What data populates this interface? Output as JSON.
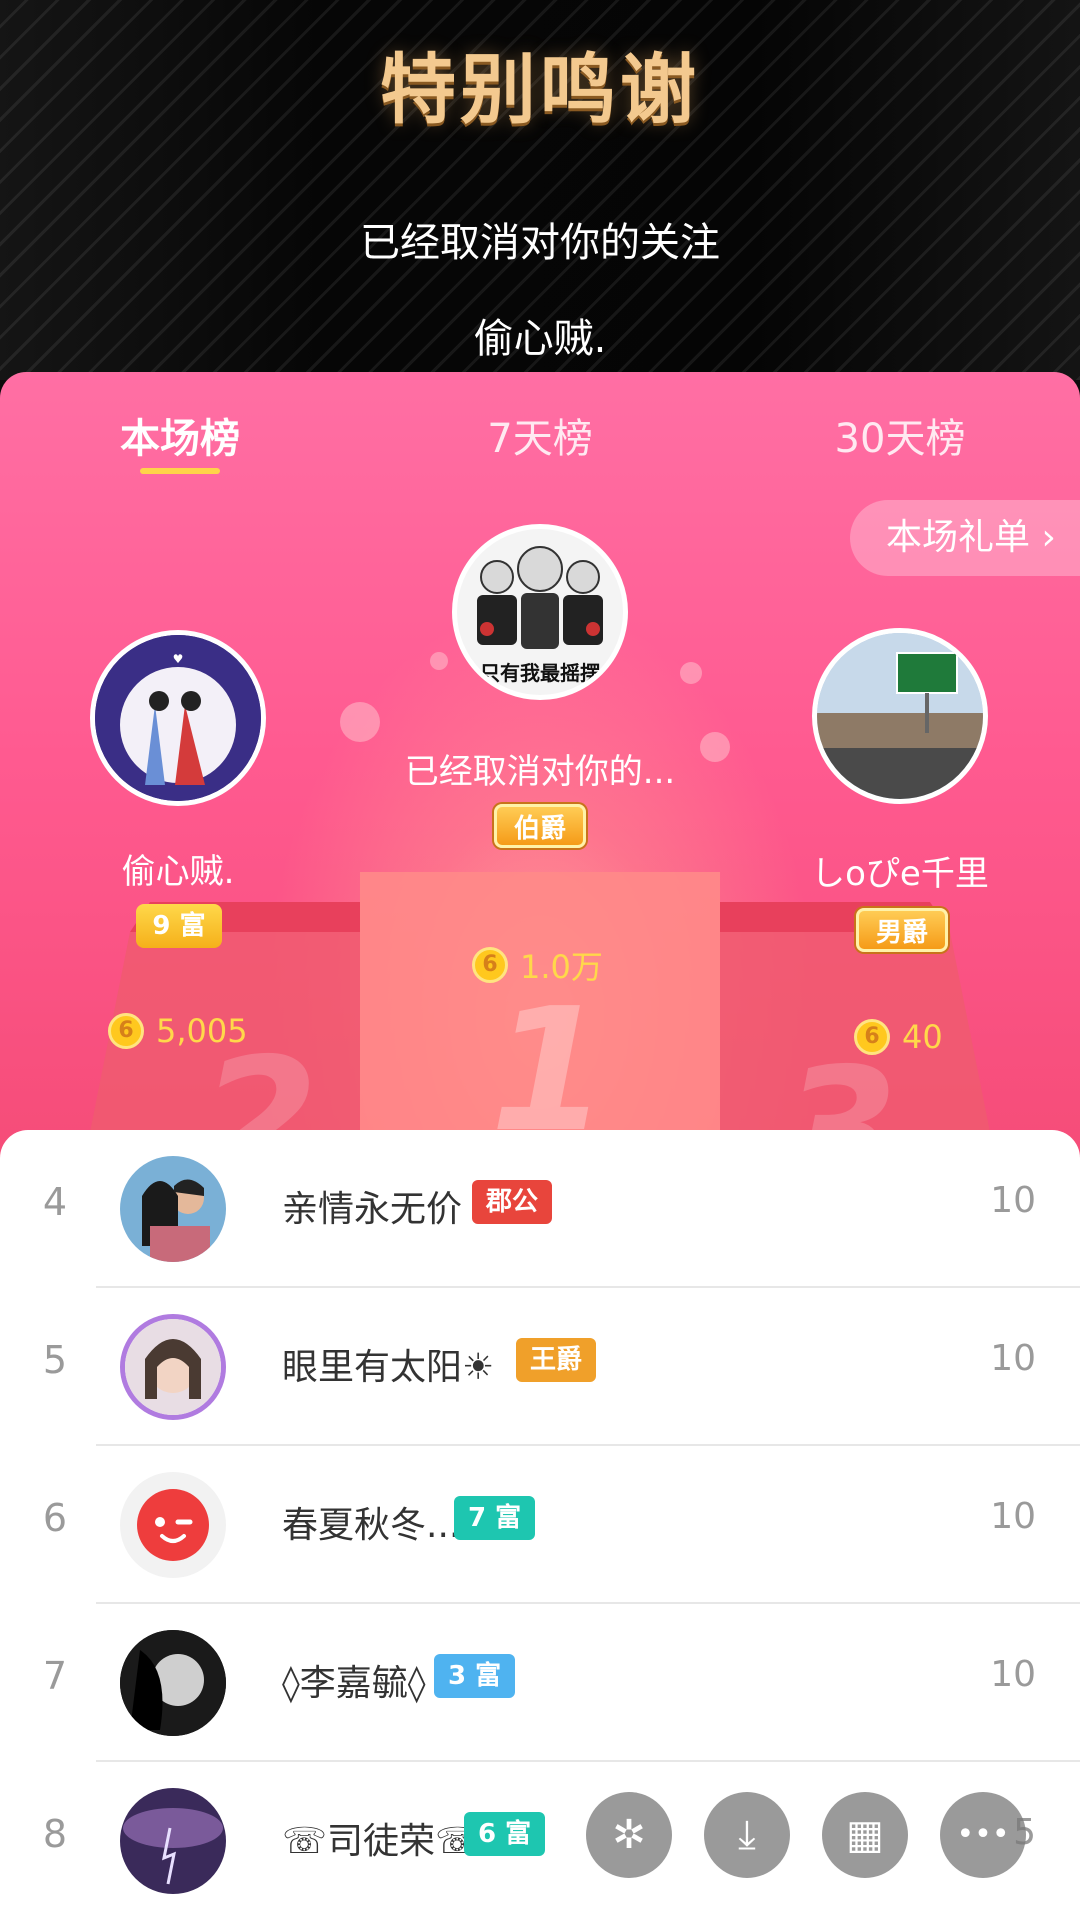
{
  "header": {
    "title": "特别鸣谢",
    "line1": "已经取消对你的关注",
    "line2": "偷心贼."
  },
  "tabs": [
    {
      "label": "本场榜",
      "active": true
    },
    {
      "label": "7天榜",
      "active": false
    },
    {
      "label": "30天榜",
      "active": false
    }
  ],
  "gift_list_button": "本场礼单 ›",
  "podium": {
    "first": {
      "name": "已经取消对你的...",
      "badge": "伯爵",
      "coins": "1.0万",
      "avatar_caption": "只有我最摇摆",
      "podium_number": "1"
    },
    "second": {
      "name": "偷心贼.",
      "badge": "9 富",
      "coins": "5,005",
      "podium_number": "2"
    },
    "third": {
      "name": "しoぴe千里",
      "badge": "男爵",
      "coins": "40",
      "podium_number": "3"
    }
  },
  "coin_symbol": "6",
  "list": [
    {
      "rank": "4",
      "name": "亲情永无价",
      "badge": "郡公",
      "badge_color": "#e8453c",
      "score": "10"
    },
    {
      "rank": "5",
      "name": "眼里有太阳☀",
      "badge": "王爵",
      "badge_color": "#f0a02a",
      "score": "10"
    },
    {
      "rank": "6",
      "name": "春夏秋冬...",
      "badge": "7 富",
      "badge_color": "#1ec6b0",
      "score": "10"
    },
    {
      "rank": "7",
      "name": "◊李嘉毓◊",
      "badge": "3 富",
      "badge_color": "#4fb3f0",
      "score": "10"
    },
    {
      "rank": "8",
      "name": "☏司徒荣☏",
      "badge": "6 富",
      "badge_color": "#1ec6b0",
      "score": "5"
    }
  ],
  "fab_icons": [
    "kuaishou-icon",
    "download-icon",
    "grid-icon",
    "more-icon"
  ],
  "fab_glyphs": [
    "✲",
    "⤓",
    "▦",
    "•••"
  ]
}
